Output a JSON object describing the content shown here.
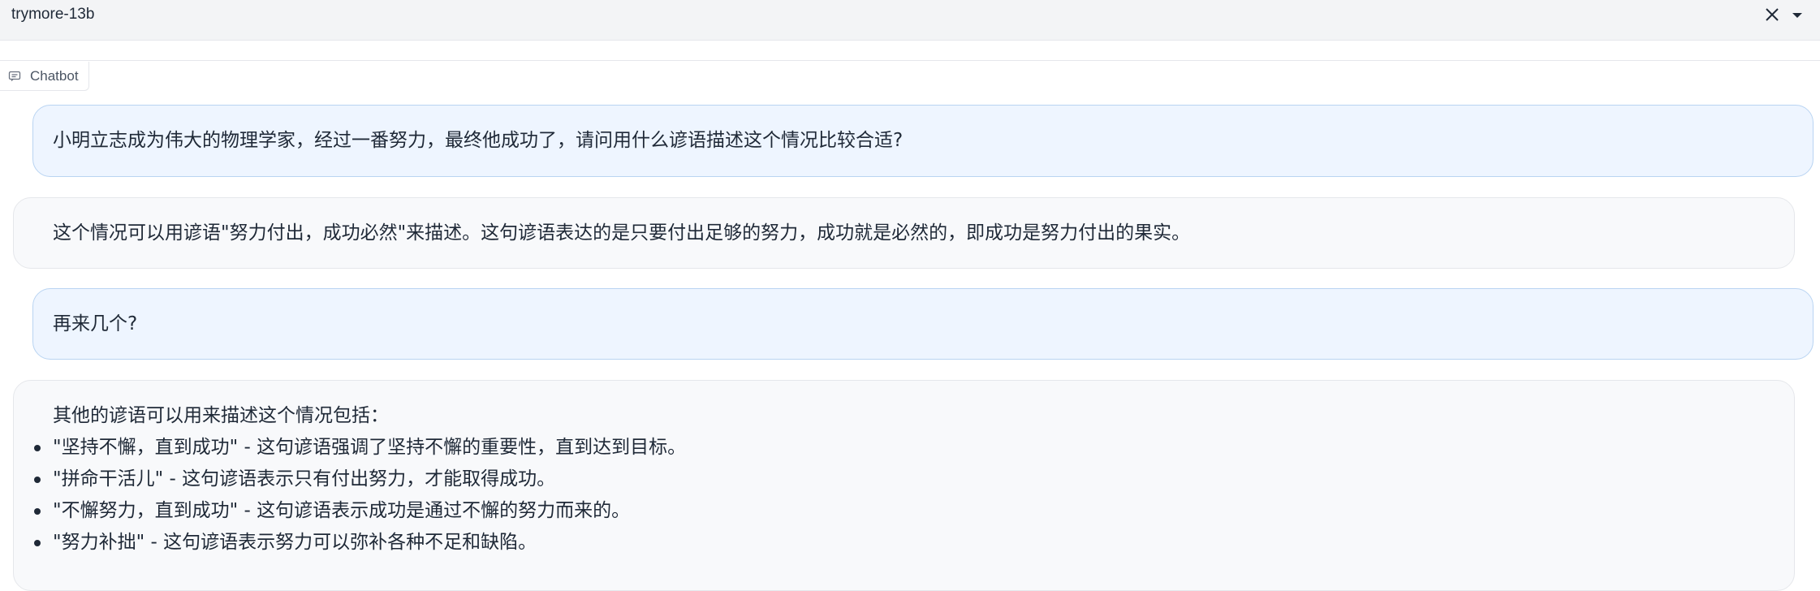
{
  "header": {
    "model_name": "trymore-13b"
  },
  "chatbot": {
    "label": "Chatbot"
  },
  "messages": [
    {
      "role": "user",
      "text": "小明立志成为伟大的物理学家，经过一番努力，最终他成功了，请问用什么谚语描述这个情况比较合适?"
    },
    {
      "role": "bot",
      "text": "这个情况可以用谚语\"努力付出，成功必然\"来描述。这句谚语表达的是只要付出足够的努力，成功就是必然的，即成功是努力付出的果实。"
    },
    {
      "role": "user",
      "text": "再来几个?"
    },
    {
      "role": "bot",
      "intro": "其他的谚语可以用来描述这个情况包括：",
      "items": [
        "\"坚持不懈，直到成功\" - 这句谚语强调了坚持不懈的重要性，直到达到目标。",
        "\"拼命干活儿\" - 这句谚语表示只有付出努力，才能取得成功。",
        "\"不懈努力，直到成功\" - 这句谚语表示成功是通过不懈的努力而来的。",
        "\"努力补拙\" - 这句谚语表示努力可以弥补各种不足和缺陷。"
      ]
    }
  ]
}
